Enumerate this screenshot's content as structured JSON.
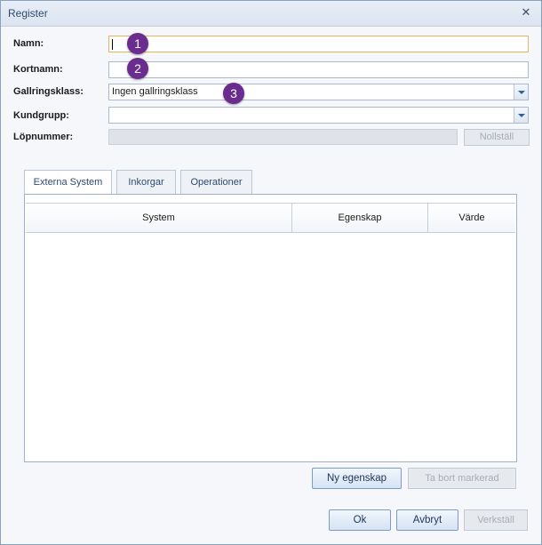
{
  "window": {
    "title": "Register"
  },
  "form": {
    "namn_label": "Namn:",
    "kortnamn_label": "Kortnamn:",
    "gallringsklass_label": "Gallringsklass:",
    "gallringsklass_value": "Ingen gallringsklass",
    "kundgrupp_label": "Kundgrupp:",
    "lopnummer_label": "Löpnummer:",
    "nollstall_label": "Nollställ"
  },
  "badges": [
    "1",
    "2",
    "3"
  ],
  "tabs": [
    {
      "label": "Externa System",
      "active": true
    },
    {
      "label": "Inkorgar",
      "active": false
    },
    {
      "label": "Operationer",
      "active": false
    }
  ],
  "table": {
    "columns": [
      "System",
      "Egenskap",
      "Värde"
    ],
    "rows": []
  },
  "panel_buttons": {
    "ny_egenskap": "Ny egenskap",
    "ta_bort": "Ta bort markerad"
  },
  "footer": {
    "ok": "Ok",
    "avbryt": "Avbryt",
    "verkstall": "Verkställ"
  },
  "colors": {
    "badge": "#6b2c8f",
    "focus_border": "#e6b45a"
  },
  "icons": {
    "close": "close-icon",
    "dropdown": "chevron-down-icon"
  }
}
